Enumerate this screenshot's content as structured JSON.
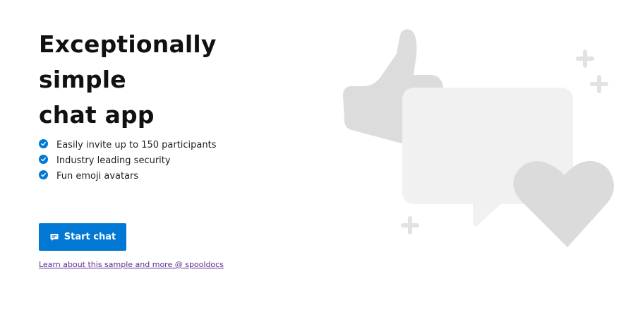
{
  "headline": {
    "line1": "Exceptionally simple",
    "line2": "chat app"
  },
  "features": [
    {
      "label": "Easily invite up to 150 participants",
      "icon": "checkmark-circle-icon"
    },
    {
      "label": "Industry leading security",
      "icon": "checkmark-circle-icon"
    },
    {
      "label": "Fun emoji avatars",
      "icon": "checkmark-circle-icon"
    }
  ],
  "start_button": {
    "label": "Start chat",
    "icon": "chat-icon"
  },
  "learn_link": {
    "label": "Learn about this sample and more @ spooldocs"
  },
  "illustration": {
    "items": [
      "thumbs-up-icon",
      "chat-bubble-icon",
      "heart-icon",
      "sparkle-plus-icon"
    ]
  },
  "colors": {
    "accent": "#0078d4",
    "link": "#5c2e91",
    "illustration_dark": "#dadada",
    "illustration_light": "#f1f1f1"
  }
}
